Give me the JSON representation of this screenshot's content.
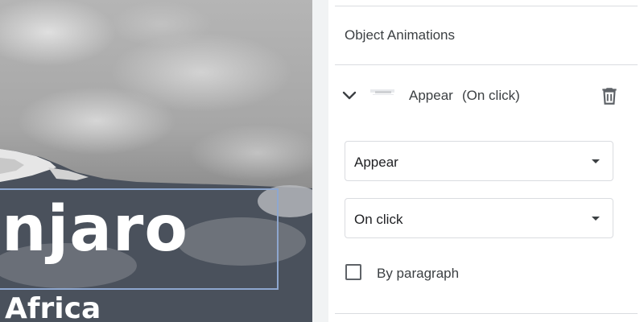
{
  "slide": {
    "title_fragment": "njaro",
    "subtitle_fragment": "Africa"
  },
  "panel": {
    "title": "Object Animations",
    "animation": {
      "name": "Appear",
      "trigger": "(On click)",
      "icons": {
        "expand": "chevron-down-icon",
        "thumbnail": "animation-thumbnail-icon",
        "delete": "trash-icon"
      }
    },
    "effect_select": {
      "value": "Appear"
    },
    "trigger_select": {
      "value": "On click"
    },
    "by_paragraph": {
      "label": "By paragraph",
      "checked": false
    }
  },
  "colors": {
    "selection_border": "#8ea7cf",
    "panel_bg": "#ffffff",
    "divider": "#dadce0",
    "text": "#3c4043"
  }
}
